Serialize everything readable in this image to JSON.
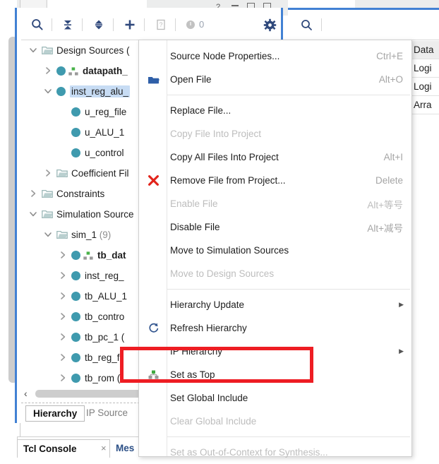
{
  "window": {
    "help_glyph": "?",
    "minimize_glyph": "—",
    "maximize_glyph": "▢",
    "close_glyph": "▢"
  },
  "sources_panel": {
    "toolbar": {
      "search_icon": "search-icon",
      "collapse_all_icon": "collapse-all-icon",
      "expand_toggle_icon": "expand-collapse-icon",
      "add_sources_icon": "plus-icon",
      "report_icon": "report-file-icon",
      "status_count": "0",
      "settings_icon": "gear-icon"
    },
    "tree": [
      {
        "label": "Design Sources (",
        "suffix": "",
        "indent": 0,
        "twisty": "down",
        "icon": "folder",
        "bold": false,
        "selected": false
      },
      {
        "label": "datapath_",
        "suffix": "",
        "indent": 1,
        "twisty": "right",
        "icon": "module-top",
        "bold": true,
        "selected": false
      },
      {
        "label": "inst_reg_alu_",
        "suffix": "",
        "indent": 1,
        "twisty": "down",
        "icon": "module",
        "bold": false,
        "selected": true
      },
      {
        "label": "u_reg_file",
        "suffix": "",
        "indent": 2,
        "twisty": "none",
        "icon": "module",
        "bold": false,
        "selected": false
      },
      {
        "label": "u_ALU_1",
        "suffix": "",
        "indent": 2,
        "twisty": "none",
        "icon": "module",
        "bold": false,
        "selected": false
      },
      {
        "label": "u_control",
        "suffix": "",
        "indent": 2,
        "twisty": "none",
        "icon": "module",
        "bold": false,
        "selected": false
      },
      {
        "label": "Coefficient Fil",
        "suffix": "",
        "indent": 1,
        "twisty": "right",
        "icon": "folder",
        "bold": false,
        "selected": false
      },
      {
        "label": "Constraints",
        "suffix": "",
        "indent": 0,
        "twisty": "right",
        "icon": "folder",
        "bold": false,
        "selected": false
      },
      {
        "label": "Simulation Source",
        "suffix": "",
        "indent": 0,
        "twisty": "down",
        "icon": "folder",
        "bold": false,
        "selected": false
      },
      {
        "label": "sim_1",
        "suffix": " (9)",
        "indent": 1,
        "twisty": "down",
        "icon": "folder",
        "bold": false,
        "selected": false
      },
      {
        "label": "tb_dat",
        "suffix": "",
        "indent": 2,
        "twisty": "right",
        "icon": "module-top",
        "bold": true,
        "selected": false
      },
      {
        "label": "inst_reg_",
        "suffix": "",
        "indent": 2,
        "twisty": "right",
        "icon": "module",
        "bold": false,
        "selected": false
      },
      {
        "label": "tb_ALU_1",
        "suffix": "",
        "indent": 2,
        "twisty": "right",
        "icon": "module",
        "bold": false,
        "selected": false
      },
      {
        "label": "tb_contro",
        "suffix": "",
        "indent": 2,
        "twisty": "right",
        "icon": "module",
        "bold": false,
        "selected": false
      },
      {
        "label": "tb_pc_1 (",
        "suffix": "",
        "indent": 2,
        "twisty": "right",
        "icon": "module",
        "bold": false,
        "selected": false
      },
      {
        "label": "tb_reg_fil",
        "suffix": "",
        "indent": 2,
        "twisty": "right",
        "icon": "module",
        "bold": false,
        "selected": false
      },
      {
        "label": "tb_rom (",
        "suffix": "",
        "indent": 2,
        "twisty": "right",
        "icon": "module",
        "bold": false,
        "selected": false
      }
    ],
    "hscrollbar": {
      "left_arrow": "‹"
    },
    "tabs": {
      "hierarchy": "Hierarchy",
      "ip_sources": "IP Source"
    }
  },
  "right_panel": {
    "search_icon": "search-icon",
    "grid_cells": [
      "Data",
      "Logi",
      "Logi",
      "Arra"
    ]
  },
  "lower_dock": {
    "tcl_console": "Tcl Console",
    "tcl_close_glyph": "×",
    "messages": "Mes"
  },
  "context_menu": {
    "items": [
      {
        "label": "Source Node Properties...",
        "accel": "Ctrl+E",
        "icon": "none",
        "disabled": false,
        "submenu": false
      },
      {
        "label": "Open File",
        "accel": "Alt+O",
        "icon": "folder-open-icon",
        "disabled": false,
        "submenu": false
      },
      {
        "separator": true
      },
      {
        "label": "Replace File...",
        "accel": "",
        "icon": "none",
        "disabled": false,
        "submenu": false
      },
      {
        "label": "Copy File Into Project",
        "accel": "",
        "icon": "none",
        "disabled": true,
        "submenu": false
      },
      {
        "label": "Copy All Files Into Project",
        "accel": "Alt+I",
        "icon": "none",
        "disabled": false,
        "submenu": false
      },
      {
        "label": "Remove File from Project...",
        "accel": "Delete",
        "icon": "remove-x-icon",
        "disabled": false,
        "submenu": false
      },
      {
        "label": "Enable File",
        "accel": "Alt+等号",
        "icon": "none",
        "disabled": true,
        "submenu": false
      },
      {
        "label": "Disable File",
        "accel": "Alt+减号",
        "icon": "none",
        "disabled": false,
        "submenu": false
      },
      {
        "label": "Move to Simulation Sources",
        "accel": "",
        "icon": "none",
        "disabled": false,
        "submenu": false
      },
      {
        "label": "Move to Design Sources",
        "accel": "",
        "icon": "none",
        "disabled": true,
        "submenu": false
      },
      {
        "separator": true
      },
      {
        "label": "Hierarchy Update",
        "accel": "",
        "icon": "none",
        "disabled": false,
        "submenu": true
      },
      {
        "label": "Refresh Hierarchy",
        "accel": "",
        "icon": "refresh-icon",
        "disabled": false,
        "submenu": false
      },
      {
        "label": "IP Hierarchy",
        "accel": "",
        "icon": "none",
        "disabled": false,
        "submenu": true
      },
      {
        "label": "Set as Top",
        "accel": "",
        "icon": "set-as-top-icon",
        "disabled": false,
        "submenu": false
      },
      {
        "label": "Set Global Include",
        "accel": "",
        "icon": "none",
        "disabled": false,
        "submenu": false
      },
      {
        "label": "Clear Global Include",
        "accel": "",
        "icon": "none",
        "disabled": true,
        "submenu": false
      },
      {
        "separator": true
      },
      {
        "label": "Set as Out-of-Context for Synthesis...",
        "accel": "",
        "icon": "none",
        "disabled": true,
        "submenu": false
      }
    ]
  },
  "annotation": {
    "highlight_color": "#ee1d23",
    "highlight_target": "Set as Top"
  }
}
